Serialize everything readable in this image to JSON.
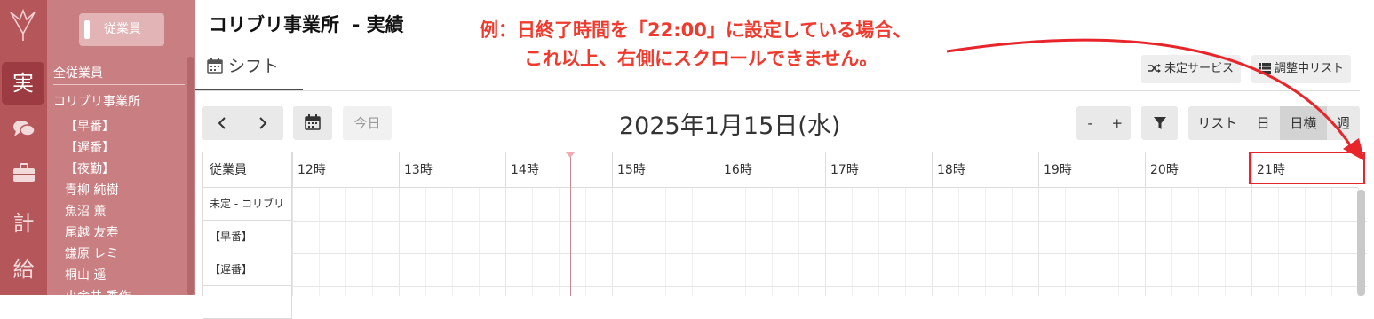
{
  "rail": {
    "items": [
      {
        "label": "実",
        "active": true
      },
      {
        "icon": "chat-bubbles-icon"
      },
      {
        "icon": "briefcase-icon"
      },
      {
        "label": "計"
      },
      {
        "label": "給"
      }
    ]
  },
  "sidebar": {
    "employee_button": "従業員",
    "all_label": "全従業員",
    "office_label": "コリブリ事業所",
    "items": [
      "【早番】",
      "【遅番】",
      "【夜勤】",
      "青柳 純樹",
      "魚沼 薫",
      "尾越 友寿",
      "鎌原 レミ",
      "桐山 遥",
      "小金井 秀作"
    ]
  },
  "header": {
    "title": "コリブリ事業所  - 実績",
    "tab_label": "シフト",
    "unassigned_service": "未定サービス",
    "adjusting_list": "調整中リスト"
  },
  "annotation": {
    "line1": "例：日終了時間を「22:00」に設定している場合、",
    "line2": "これ以上、右側にスクロールできません。"
  },
  "toolbar": {
    "today": "今日",
    "date": "2025年1月15日(水)",
    "minus": "-",
    "plus": "+",
    "views": [
      "リスト",
      "日",
      "日横",
      "週"
    ],
    "selected_view": "日横"
  },
  "calendar": {
    "resource_header": "従業員",
    "hours": [
      "12時",
      "13時",
      "14時",
      "15時",
      "16時",
      "17時",
      "18時",
      "19時",
      "20時",
      "21時"
    ],
    "rows": [
      "未定 - コリブリ",
      "【早番】",
      "【遅番】",
      ""
    ]
  },
  "colors": {
    "rail": "#b5565b",
    "sidebar": "#c97f82",
    "annotation": "#f03a2e",
    "highlight": "#e8252a"
  }
}
